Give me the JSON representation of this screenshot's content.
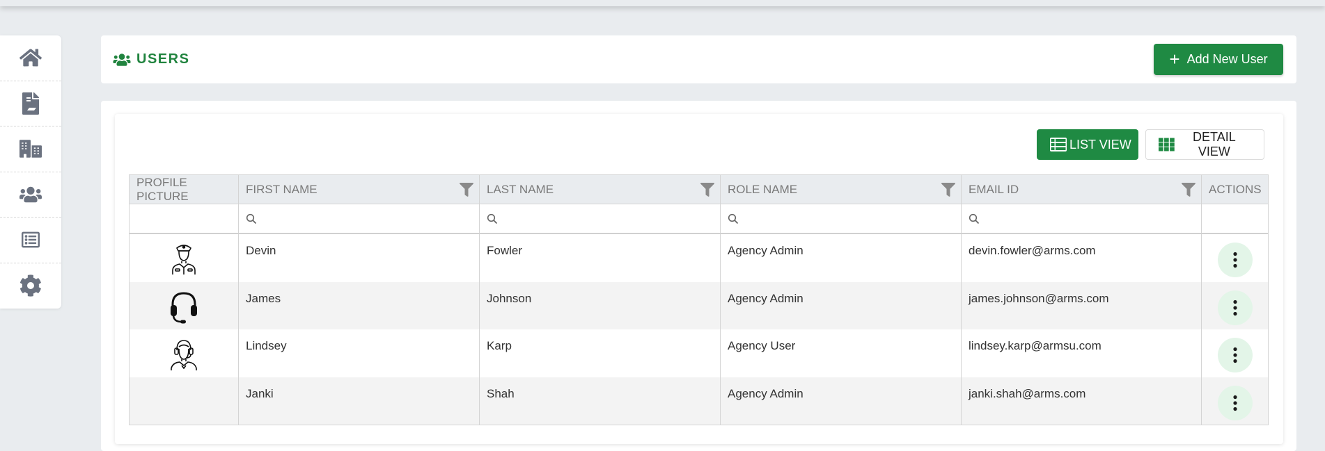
{
  "sidebar": {
    "items": [
      {
        "icon": "home-icon"
      },
      {
        "icon": "document-icon"
      },
      {
        "icon": "buildings-icon"
      },
      {
        "icon": "users-icon"
      },
      {
        "icon": "list-icon"
      },
      {
        "icon": "gear-icon"
      }
    ]
  },
  "header": {
    "title": "USERS",
    "add_button_label": "Add New User"
  },
  "view_toggle": {
    "list_label": "LIST VIEW",
    "detail_label": "DETAIL VIEW"
  },
  "table": {
    "columns": [
      "PROFILE PICTURE",
      "FIRST NAME",
      "LAST NAME",
      "ROLE NAME",
      "EMAIL ID",
      "ACTIONS"
    ],
    "rows": [
      {
        "avatar": "police-officer-icon",
        "first": "Devin",
        "last": "Fowler",
        "role": "Agency Admin",
        "email": "devin.fowler@arms.com"
      },
      {
        "avatar": "headset-icon",
        "first": "James",
        "last": "Johnson",
        "role": "Agency Admin",
        "email": "james.johnson@arms.com"
      },
      {
        "avatar": "support-agent-icon",
        "first": "Lindsey",
        "last": "Karp",
        "role": "Agency User",
        "email": "lindsey.karp@armsu.com"
      },
      {
        "avatar": "",
        "first": "Janki",
        "last": "Shah",
        "role": "Agency Admin",
        "email": "janki.shah@arms.com"
      }
    ]
  },
  "colors": {
    "accent": "#1f8a43",
    "title_green": "#21843f",
    "kebab_bg": "#e3f5e8"
  }
}
